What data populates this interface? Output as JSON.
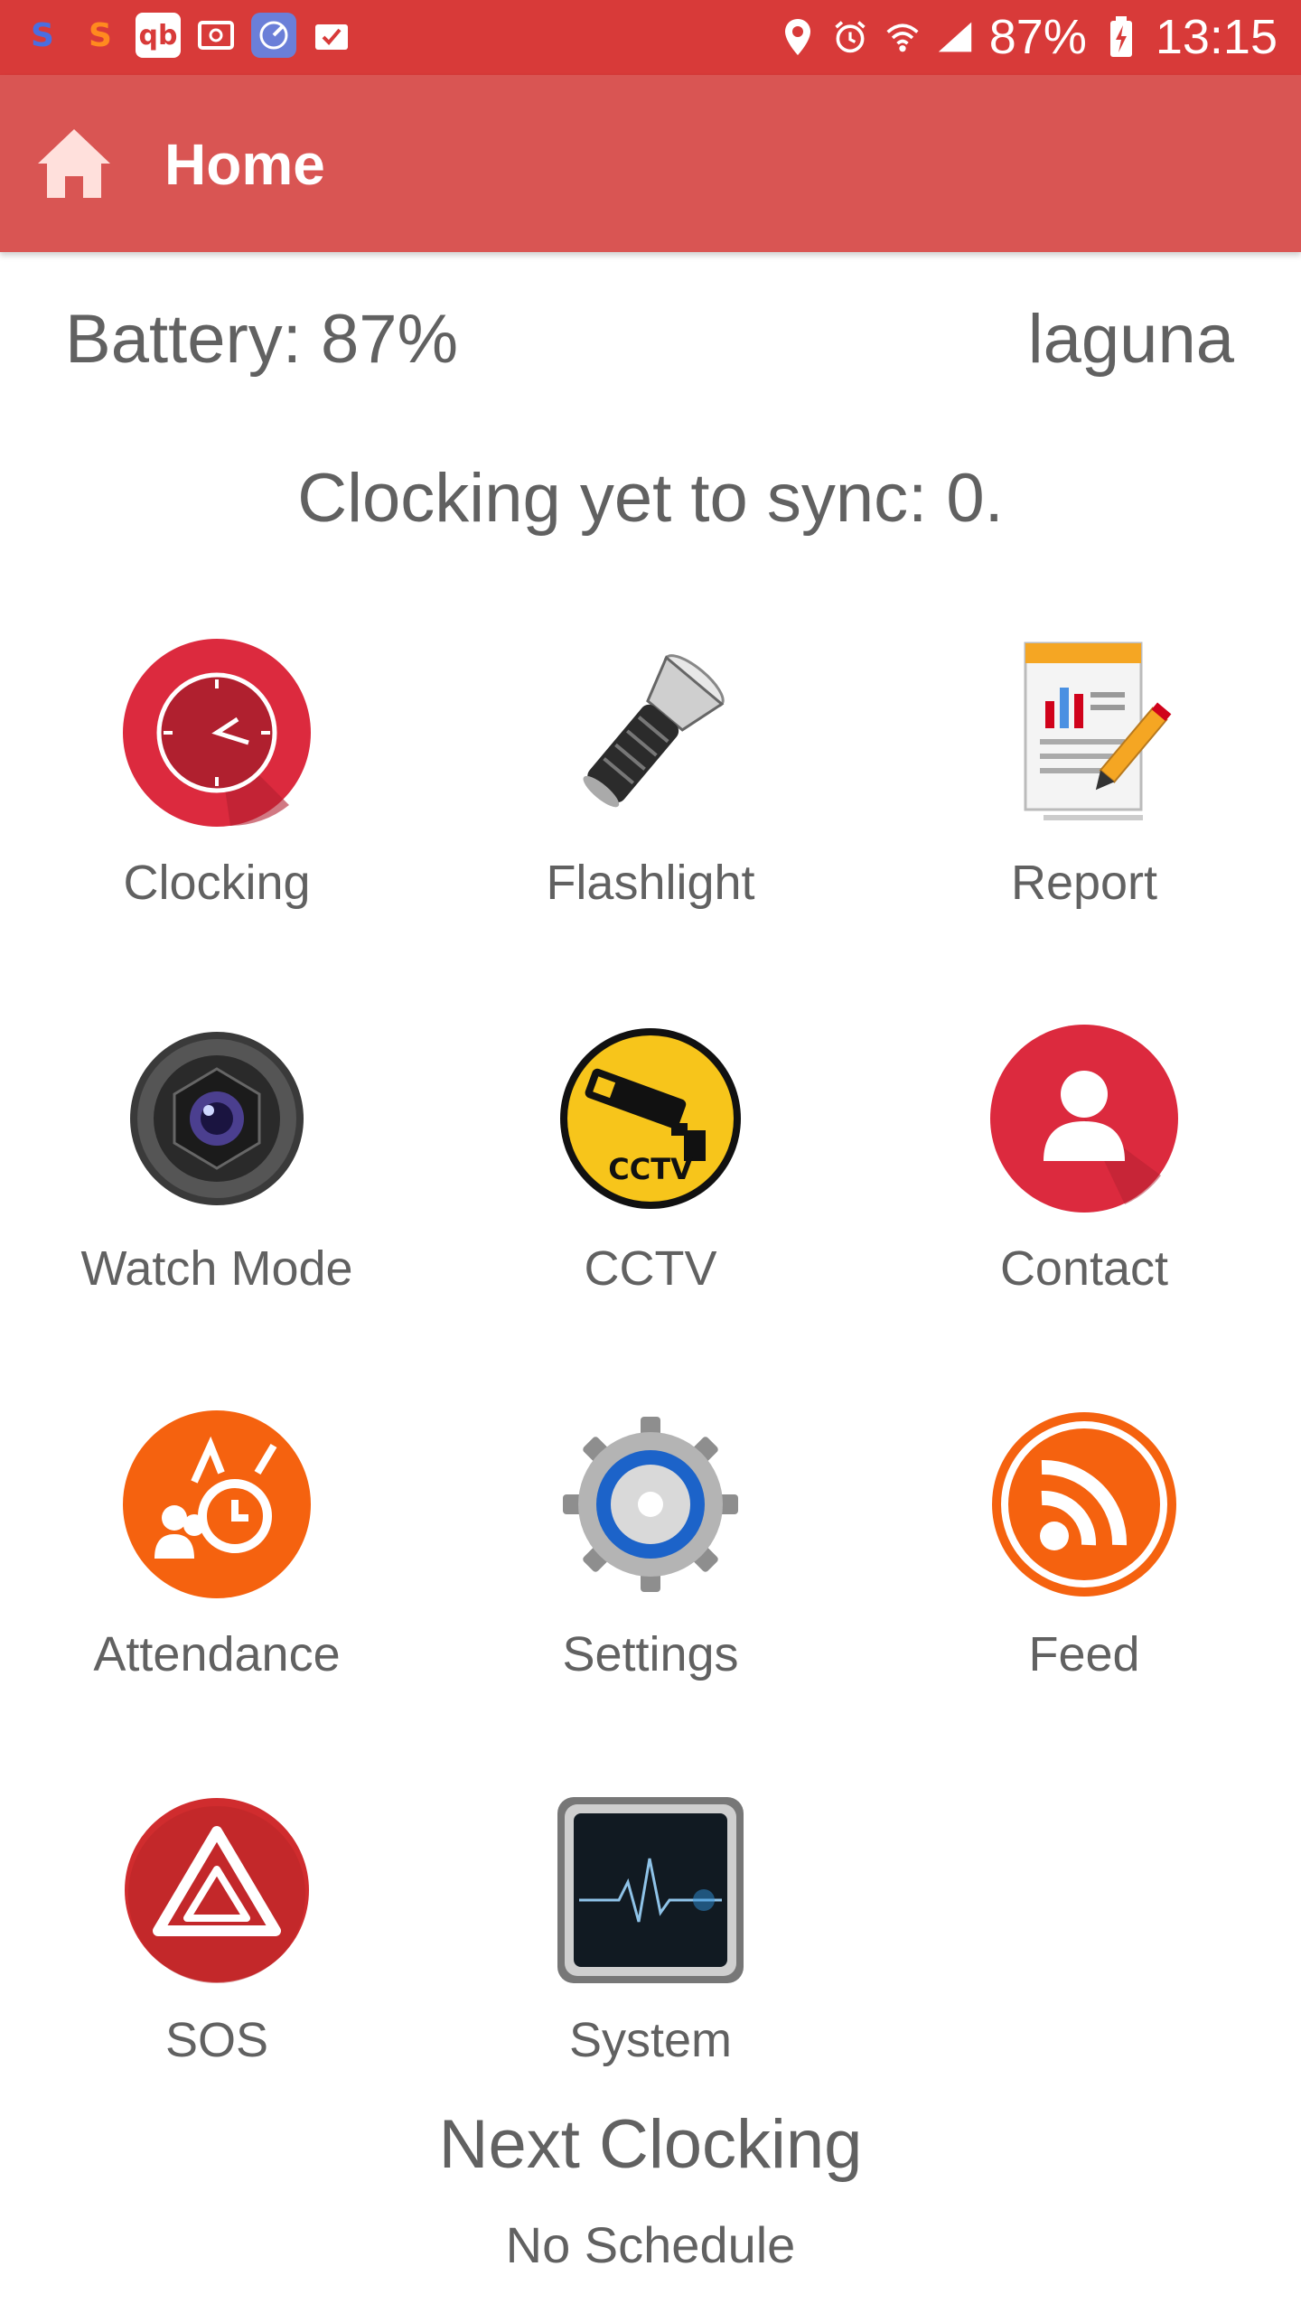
{
  "status_bar": {
    "notification_icons": [
      "s-app-icon-blue",
      "s-app-icon-orange",
      "qb-icon",
      "message-icon",
      "radar-icon",
      "calendar-check-icon"
    ],
    "location_icon": "location-pin-icon",
    "alarm_icon": "alarm-icon",
    "wifi_icon": "wifi-icon",
    "signal_icon": "signal-icon",
    "battery_percent": "87%",
    "battery_icon": "battery-charging-icon",
    "time": "13:15"
  },
  "app_bar": {
    "icon": "home-icon",
    "title": "Home"
  },
  "info": {
    "battery": "Battery: 87%",
    "username": "laguna",
    "sync": "Clocking yet to sync: 0."
  },
  "menu": [
    {
      "label": "Clocking",
      "icon": "clock-icon"
    },
    {
      "label": "Flashlight",
      "icon": "flashlight-icon"
    },
    {
      "label": "Report",
      "icon": "report-icon"
    },
    {
      "label": "Watch Mode",
      "icon": "camera-lens-icon"
    },
    {
      "label": "CCTV",
      "icon": "cctv-icon"
    },
    {
      "label": "Contact",
      "icon": "contact-person-icon"
    },
    {
      "label": "Attendance",
      "icon": "attendance-icon"
    },
    {
      "label": "Settings",
      "icon": "settings-gear-icon"
    },
    {
      "label": "Feed",
      "icon": "rss-feed-icon"
    },
    {
      "label": "SOS",
      "icon": "sos-warning-icon"
    },
    {
      "label": "System",
      "icon": "system-monitor-icon"
    }
  ],
  "next_clocking": {
    "title": "Next Clocking",
    "value": "No Schedule"
  },
  "colors": {
    "status_bar": "#d83a39",
    "app_bar": "#d95553",
    "text": "#616161",
    "red_icon": "#dc2a3e",
    "orange_icon": "#f5620f"
  }
}
